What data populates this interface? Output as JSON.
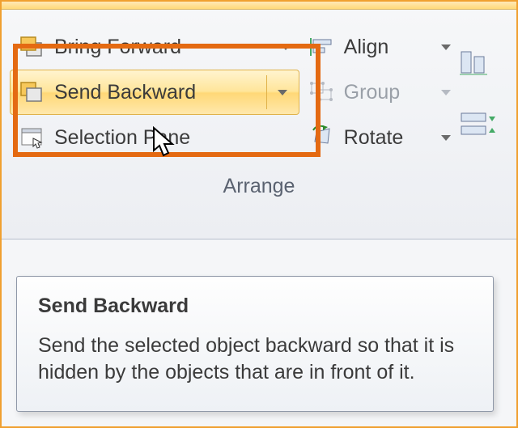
{
  "ribbon": {
    "group_label": "Arrange",
    "bring_forward": "Bring Forward",
    "send_backward": "Send Backward",
    "selection_pane": "Selection Pane",
    "align": "Align",
    "group": "Group",
    "rotate": "Rotate"
  },
  "tooltip": {
    "title": "Send Backward",
    "body": "Send the selected object backward so that it is hidden by the objects that are in front of it."
  }
}
